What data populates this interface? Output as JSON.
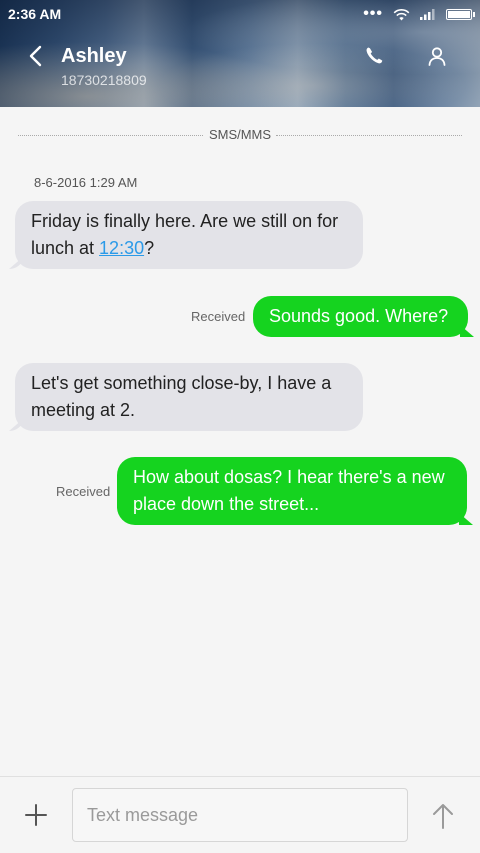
{
  "status_bar": {
    "time": "2:36 AM",
    "icons": [
      "more-dots-icon",
      "wifi-icon",
      "signal-icon",
      "battery-icon"
    ]
  },
  "header": {
    "contact_name": "Ashley",
    "contact_number": "18730218809",
    "icons": [
      "back-arrow-icon",
      "phone-icon",
      "person-icon"
    ]
  },
  "thread": {
    "channel_label": "SMS/MMS",
    "timestamp": "8-6-2016 1:29 AM",
    "messages": [
      {
        "direction": "incoming",
        "text_before_link": "Friday is finally here. Are we still on for lunch at ",
        "link_text": "12:30",
        "text_after_link": "?"
      },
      {
        "direction": "outgoing",
        "status": "Received",
        "text": "Sounds good. Where?"
      },
      {
        "direction": "incoming",
        "text": "Let's get something close-by, I have a meeting at 2."
      },
      {
        "direction": "outgoing",
        "status": "Received",
        "text": "How about dosas? I hear there's a new place down the street..."
      }
    ]
  },
  "composer": {
    "placeholder": "Text message",
    "value": "",
    "icons": [
      "plus-icon",
      "send-arrow-icon"
    ]
  },
  "colors": {
    "incoming_bubble": "#e3e3e8",
    "outgoing_bubble": "#15d31f",
    "link": "#2b9ae8",
    "background": "#f5f5f5"
  }
}
